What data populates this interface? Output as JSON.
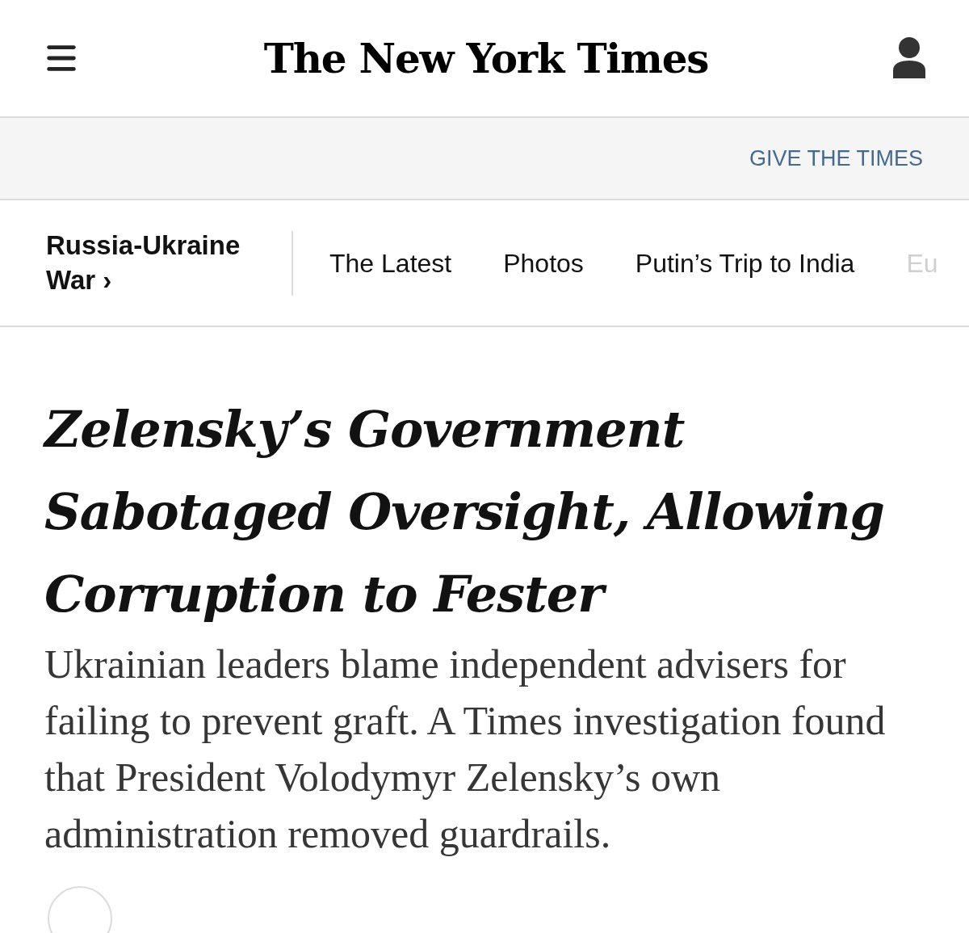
{
  "header": {
    "logo": "The New York Times"
  },
  "promo_bar": {
    "link": "GIVE THE TIMES"
  },
  "section_nav": {
    "section": "Russia-Ukraine War",
    "chevron": "›",
    "items": [
      {
        "label": "The Latest",
        "faded": false
      },
      {
        "label": "Photos",
        "faded": false
      },
      {
        "label": "Putin’s Trip to India",
        "faded": false
      },
      {
        "label": "Eu",
        "faded": true
      }
    ]
  },
  "article": {
    "headline": "Zelensky’s Government Sabotaged Oversight, Allowing Corruption to Fester",
    "summary": "Ukrainian leaders blame independent advisers for failing to prevent graft. A Times investigation found that President Volodymyr Zelensky’s own administration removed guardrails."
  }
}
